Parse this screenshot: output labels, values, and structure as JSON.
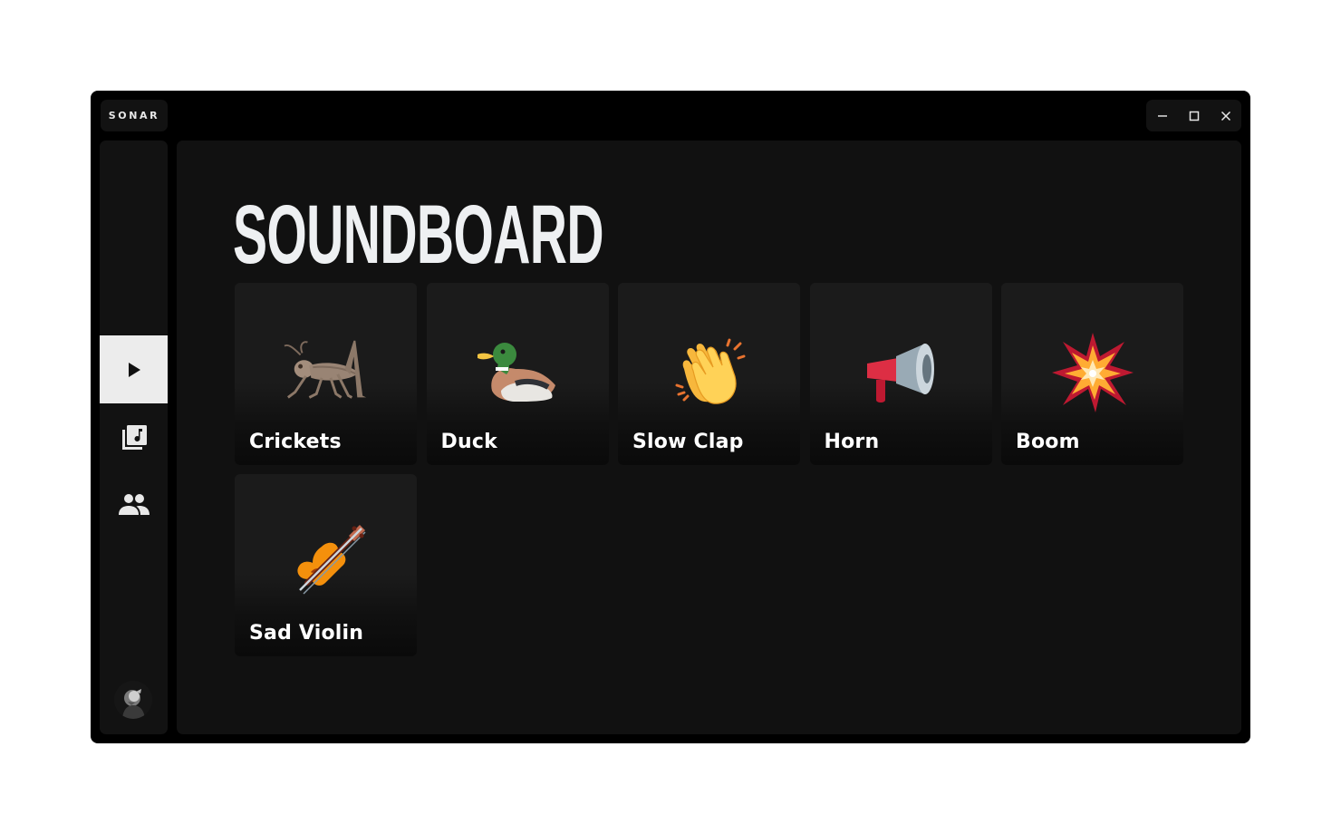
{
  "app": {
    "brand": "SONAR"
  },
  "window_controls": [
    "minimize-icon",
    "maximize-icon",
    "close-icon"
  ],
  "sidebar": {
    "items": [
      {
        "icon": "play-icon",
        "active": true
      },
      {
        "icon": "music-library-icon",
        "active": false
      },
      {
        "icon": "people-icon",
        "active": false
      }
    ],
    "avatar": "avatar"
  },
  "main": {
    "title": "SOUNDBOARD",
    "sounds": [
      {
        "label": "Crickets",
        "icon": "cricket-icon"
      },
      {
        "label": "Duck",
        "icon": "duck-icon"
      },
      {
        "label": "Slow Clap",
        "icon": "clapping-hands-icon"
      },
      {
        "label": "Horn",
        "icon": "megaphone-icon"
      },
      {
        "label": "Boom",
        "icon": "explosion-icon"
      },
      {
        "label": "Sad Violin",
        "icon": "violin-icon"
      }
    ]
  },
  "colors": {
    "window_bg": "#000000",
    "panel_bg": "#121212",
    "main_bg": "#111111",
    "active_nav": "#ececec",
    "text": "#ffffff"
  }
}
